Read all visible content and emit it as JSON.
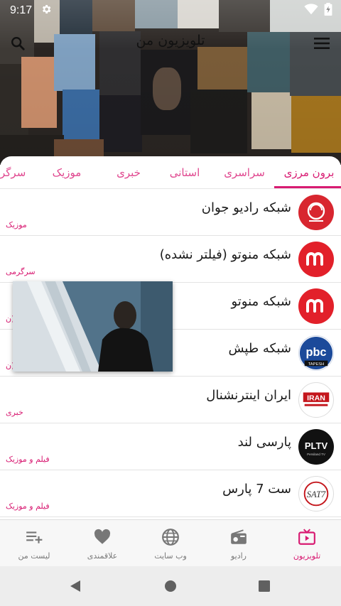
{
  "status_bar": {
    "time": "9:17",
    "icons": [
      "settings-gear-icon",
      "wifi-icon",
      "battery-icon"
    ]
  },
  "app_bar": {
    "title": "تلویزیون من",
    "search_icon": "search-icon",
    "menu_icon": "hamburger-menu-icon"
  },
  "tabs": [
    {
      "label": "برون مرزی",
      "active": true
    },
    {
      "label": "سراسری",
      "active": false
    },
    {
      "label": "استانی",
      "active": false
    },
    {
      "label": "خبری",
      "active": false
    },
    {
      "label": "موزیک",
      "active": false
    },
    {
      "label": "سرگر",
      "active": false
    }
  ],
  "channels": [
    {
      "name": "شبکه رادیو جوان",
      "category": "موزیک",
      "logo": "radio-javan-logo"
    },
    {
      "name": "شبکه منوتو (فیلتر نشده)",
      "category": "سرگرمی",
      "logo": "manoto-logo"
    },
    {
      "name": "شبکه منوتو",
      "category": "ن)",
      "logo": "manoto-logo"
    },
    {
      "name": "شبکه طپش",
      "category": "ن)",
      "logo": "pbc-tapesh-logo"
    },
    {
      "name": "ایران اینترنشنال",
      "category": "خبری",
      "logo": "iran-international-logo"
    },
    {
      "name": "پارسی لند",
      "category": "فیلم و موزیک",
      "logo": "plt-v-logo"
    },
    {
      "name": "ست 7 پارس",
      "category": "فیلم و موزیک",
      "logo": "sat7-pars-logo"
    }
  ],
  "logo_texts": {
    "pbc": "pbc",
    "pbc_sub": "TAPESH",
    "iran": "IRAN",
    "plt": "PLTV",
    "plt_sub": "Persiland TV",
    "sat7": "SAT7"
  },
  "bottom_nav": [
    {
      "label": "تلویزیون",
      "icon": "tv-icon",
      "active": true
    },
    {
      "label": "رادیو",
      "icon": "radio-icon",
      "active": false
    },
    {
      "label": "وب سایت",
      "icon": "globe-icon",
      "active": false
    },
    {
      "label": "علاقمندی",
      "icon": "heart-icon",
      "active": false
    },
    {
      "label": "لیست من",
      "icon": "playlist-add-icon",
      "active": false
    }
  ],
  "system_nav": {
    "back": "back-triangle-icon",
    "home": "home-circle-icon",
    "recents": "recents-square-icon"
  },
  "colors": {
    "accent": "#d81b72",
    "tab_text": "#e0478f",
    "manoto_red": "#e2202a",
    "nav_bg": "#f7f7f7"
  }
}
